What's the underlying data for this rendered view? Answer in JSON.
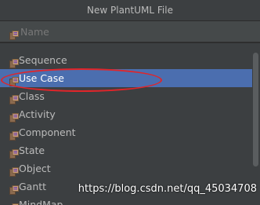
{
  "dialog": {
    "title": "New PlantUML File"
  },
  "name_field": {
    "placeholder": "Name",
    "value": "",
    "icon": "plantuml-file-icon"
  },
  "templates": [
    {
      "label": "Sequence",
      "selected": false,
      "icon": "plantuml-file-icon"
    },
    {
      "label": "Use Case",
      "selected": true,
      "icon": "plantuml-file-icon"
    },
    {
      "label": "Class",
      "selected": false,
      "icon": "plantuml-file-icon"
    },
    {
      "label": "Activity",
      "selected": false,
      "icon": "plantuml-file-icon"
    },
    {
      "label": "Component",
      "selected": false,
      "icon": "plantuml-file-icon"
    },
    {
      "label": "State",
      "selected": false,
      "icon": "plantuml-file-icon"
    },
    {
      "label": "Object",
      "selected": false,
      "icon": "plantuml-file-icon"
    },
    {
      "label": "Gantt",
      "selected": false,
      "icon": "plantuml-file-icon"
    },
    {
      "label": "MindMap",
      "selected": false,
      "icon": "plantuml-file-icon"
    }
  ],
  "watermark": "https://blog.csdn.net/qq_45034708",
  "colors": {
    "background": "#3c3f41",
    "selection": "#4b6eaf",
    "annotation": "#e0252a"
  }
}
